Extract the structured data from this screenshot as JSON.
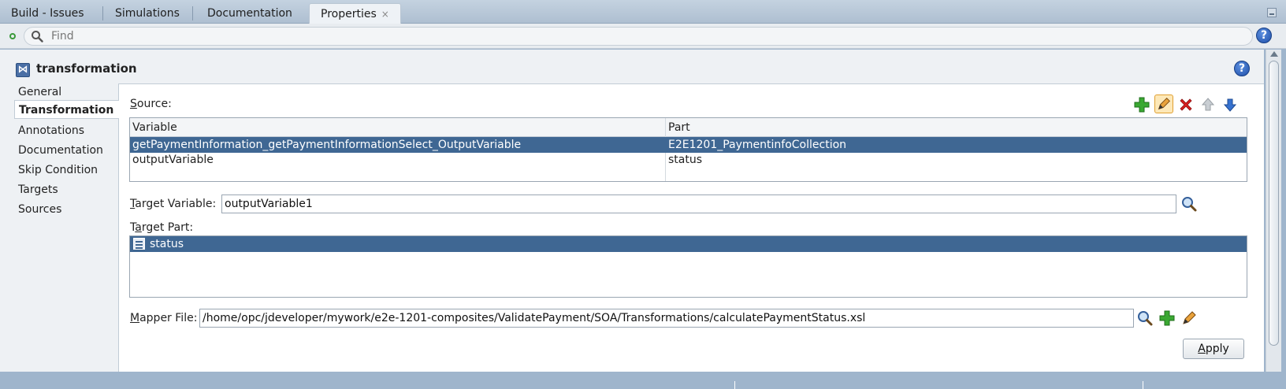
{
  "tabs": [
    {
      "label": "Build - Issues"
    },
    {
      "label": "Simulations"
    },
    {
      "label": "Documentation"
    },
    {
      "label": "Properties",
      "close": "×"
    }
  ],
  "find": {
    "placeholder": "Find"
  },
  "help_label": "?",
  "page": {
    "title": "transformation"
  },
  "nav": [
    {
      "label": "General"
    },
    {
      "label": "Transformation"
    },
    {
      "label": "Annotations"
    },
    {
      "label": "Documentation"
    },
    {
      "label": "Skip Condition"
    },
    {
      "label": "Targets"
    },
    {
      "label": "Sources"
    }
  ],
  "source": {
    "label_first": "S",
    "label_rest": "ource:",
    "columns": [
      "Variable",
      "Part"
    ],
    "rows": [
      {
        "variable": "getPaymentInformation_getPaymentInformationSelect_OutputVariable",
        "part": "E2E1201_PaymentinfoCollection"
      },
      {
        "variable": "outputVariable",
        "part": "status"
      }
    ]
  },
  "target_variable": {
    "label_first": "T",
    "label_rest": "arget Variable:",
    "value": "outputVariable1"
  },
  "target_part": {
    "label_first": "T",
    "label_u": "a",
    "label_rest": "rget Part:",
    "items": [
      "status"
    ]
  },
  "mapper_file": {
    "label_first": "M",
    "label_rest": "apper File:",
    "value": "/home/opc/jdeveloper/mywork/e2e-1201-composites/ValidatePayment/SOA/Transformations/calculatePaymentStatus.xsl"
  },
  "apply_first": "A",
  "apply_rest": "pply",
  "colors": {
    "selection": "#3f6793",
    "accent_green": "#3aa832",
    "delete_red": "#d92020",
    "arrow_blue": "#3672d0"
  }
}
